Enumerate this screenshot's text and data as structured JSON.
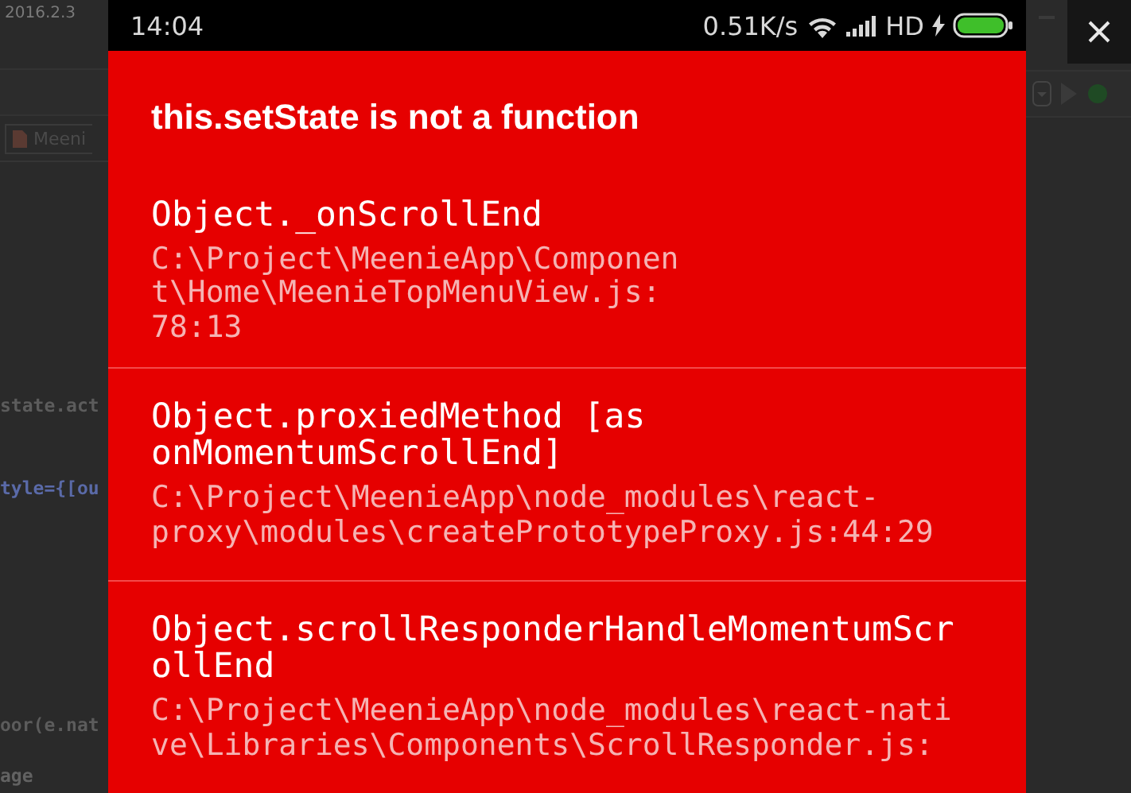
{
  "ide": {
    "title": "2016.2.3",
    "tab": "Meeni",
    "code_lines": [
      "state.act",
      "tyle={[ou",
      "oor(e.nat",
      "age"
    ]
  },
  "status_bar": {
    "time": "14:04",
    "speed": "0.51K/s",
    "network": "HD"
  },
  "error": {
    "title": "this.setState is not a function",
    "frames": [
      {
        "method_lines": [
          "Object._onScrollEnd"
        ],
        "file_lines": [
          "C:\\Project\\MeenieApp\\Componen",
          "t\\Home\\MeenieTopMenuView.js:",
          "78:13"
        ]
      },
      {
        "method_lines": [
          "Object.proxiedMethod [as",
          "onMomentumScrollEnd]"
        ],
        "file_lines": [
          "C:\\Project\\MeenieApp\\node_modules\\react-",
          "proxy\\modules\\createPrototypeProxy.js:44:29"
        ]
      },
      {
        "method_lines": [
          "Object.scrollResponderHandleMomentumScr",
          "ollEnd"
        ],
        "file_lines": [
          "C:\\Project\\MeenieApp\\node_modules\\react-nati",
          "ve\\Libraries\\Components\\ScrollResponder.js:"
        ]
      }
    ]
  }
}
